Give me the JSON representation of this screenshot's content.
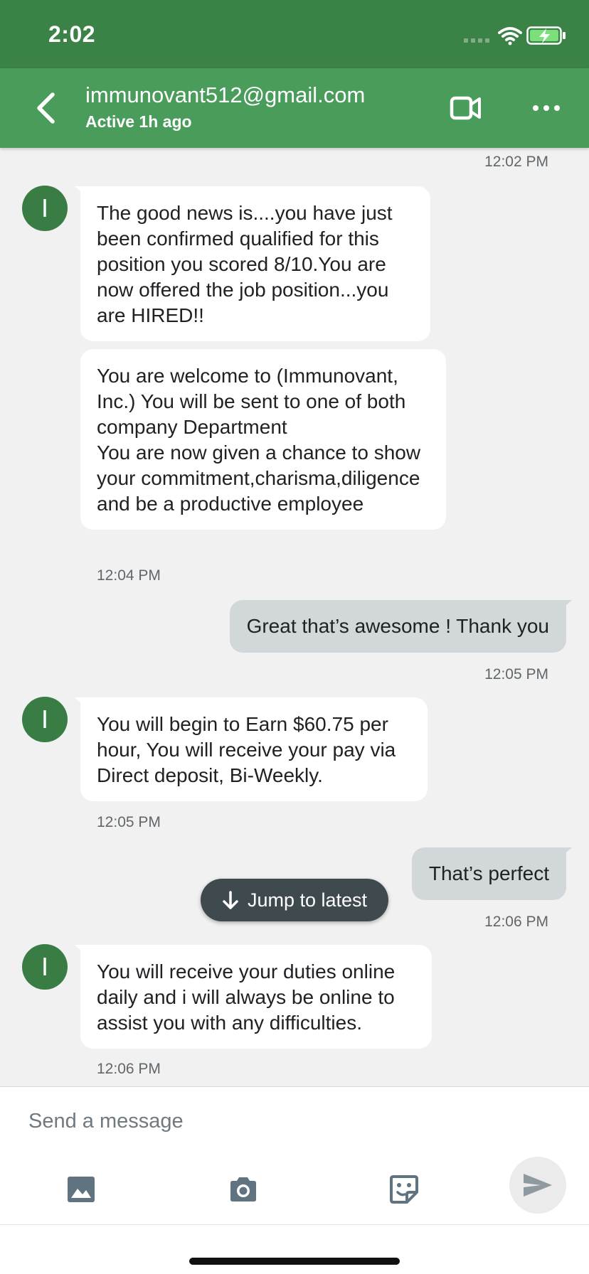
{
  "status_bar": {
    "time": "2:02"
  },
  "header": {
    "contact_name": "immunovant512@gmail.com",
    "contact_status": "Active 1h ago"
  },
  "chat": {
    "top_timestamp": "12:02 PM",
    "messages": [
      {
        "sender": "contact",
        "avatar_initial": "I",
        "text": "The good news is....you have just been confirmed qualified for this position you scored 8/10.You are now offered the job position...you are HIRED!!"
      },
      {
        "sender": "contact",
        "text": "You are welcome to (Immunovant, Inc.) You will be sent to one of both company Department\nYou are now given a chance to show your commitment,charisma,diligence and be a productive employee",
        "timestamp": "12:04 PM"
      },
      {
        "sender": "me",
        "text": "Great that’s awesome ! Thank you",
        "timestamp": "12:05 PM"
      },
      {
        "sender": "contact",
        "avatar_initial": "I",
        "text": "You will begin to Earn $60.75 per hour, You will receive your pay via Direct deposit, Bi-Weekly.",
        "timestamp": "12:05 PM"
      },
      {
        "sender": "me",
        "text": "That’s perfect",
        "timestamp": "12:06 PM"
      },
      {
        "sender": "contact",
        "avatar_initial": "I",
        "text": "You will receive your duties online daily and i will always be online to assist you with any difficulties.",
        "timestamp": "12:06 PM"
      }
    ]
  },
  "jump_button": {
    "label": "Jump to latest"
  },
  "composer": {
    "placeholder": "Send a message"
  },
  "colors": {
    "status_bar": "#3a8245",
    "header": "#4a9c5b",
    "avatar": "#3a7d44",
    "outgoing_bubble": "#d2d7d9",
    "incoming_bubble": "#ffffff",
    "background": "#f1f1f1",
    "icon_gray": "#5f7480"
  },
  "icons": [
    "back-arrow-icon",
    "video-camera-icon",
    "more-dots-icon",
    "image-icon",
    "camera-icon",
    "sticker-icon",
    "send-icon",
    "arrow-down-icon",
    "wifi-icon",
    "battery-charging-icon",
    "signal-icon"
  ]
}
